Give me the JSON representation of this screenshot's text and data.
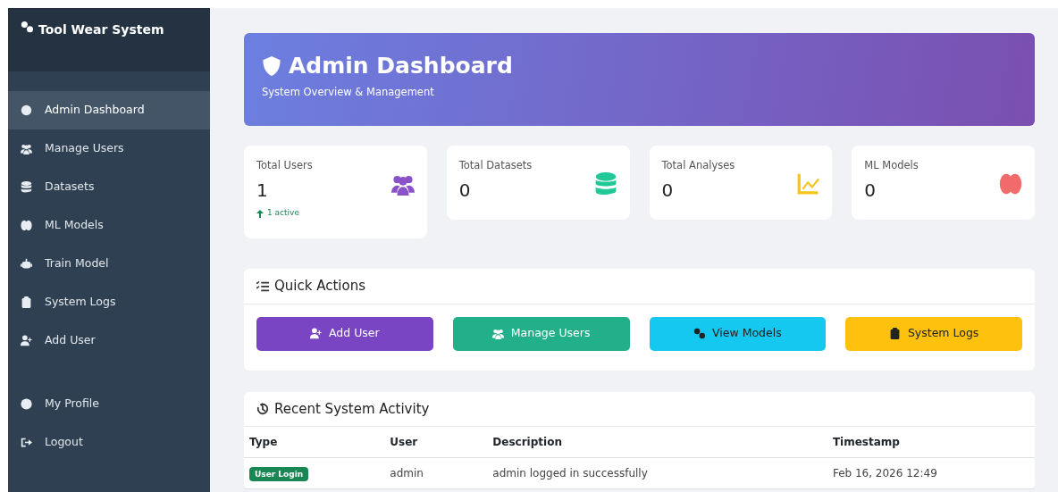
{
  "sidebar": {
    "brand": "Tool Wear System",
    "items": [
      {
        "label": "Admin Dashboard",
        "selected": true
      },
      {
        "label": "Manage Users",
        "selected": false
      },
      {
        "label": "Datasets",
        "selected": false
      },
      {
        "label": "ML Models",
        "selected": false
      },
      {
        "label": "Train Model",
        "selected": false
      },
      {
        "label": "System Logs",
        "selected": false
      },
      {
        "label": "Add User",
        "selected": false
      }
    ],
    "bottom_items": [
      {
        "label": "My Profile",
        "selected": false
      },
      {
        "label": "Logout",
        "selected": false
      }
    ]
  },
  "header": {
    "title": "Admin Dashboard",
    "subtitle": "System Overview & Management"
  },
  "stats": [
    {
      "label": "Total Users",
      "value": "1",
      "note": "1 active",
      "color": "#8a52c9"
    },
    {
      "label": "Total Datasets",
      "value": "0",
      "color": "#20c997"
    },
    {
      "label": "Total Analyses",
      "value": "0",
      "color": "#f5c518"
    },
    {
      "label": "ML Models",
      "value": "0",
      "color": "#f26b6b"
    }
  ],
  "quick_actions": {
    "title": "Quick Actions",
    "buttons": [
      {
        "label": "Add User",
        "color": "#7a45c2"
      },
      {
        "label": "Manage Users",
        "color": "#22b08b"
      },
      {
        "label": "View Models",
        "color": "#14c8ef"
      },
      {
        "label": "System Logs",
        "color": "#fdc10e"
      }
    ]
  },
  "activity": {
    "title": "Recent System Activity",
    "columns": [
      "Type",
      "User",
      "Description",
      "Timestamp"
    ],
    "rows": [
      [
        "User Login",
        "admin",
        "admin logged in successfully",
        "Feb 16, 2026 12:49"
      ]
    ]
  }
}
